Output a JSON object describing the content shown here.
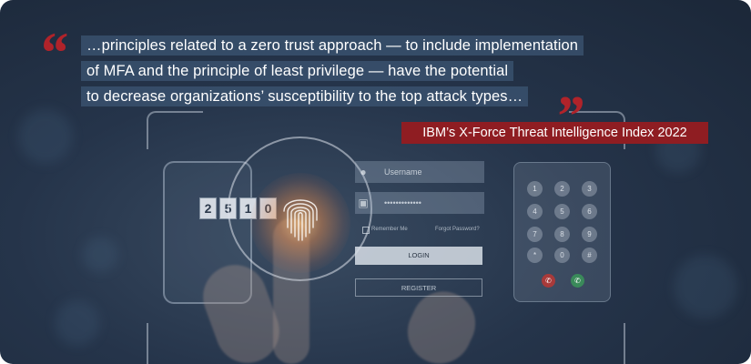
{
  "quote": {
    "lines": [
      "…principles related to a zero trust approach — to include implementation",
      "of MFA and the principle of least privilege — have the potential",
      "to decrease organizations’ susceptibility to the top attack types…"
    ],
    "source": "IBM’s X-Force Threat Intelligence Index 2022"
  },
  "colors": {
    "accent": "#8f1d22",
    "quote_mark": "#b0232a",
    "background": "#25344a"
  },
  "illustration": {
    "counter_digits": [
      "2",
      "5",
      "1",
      "0"
    ],
    "login_form": {
      "username_placeholder": "Username",
      "password_value": "•••••••••••••",
      "remember_label": "Remember Me",
      "forgot_label": "Forgot Password?",
      "login_label": "LOGIN",
      "register_label": "REGISTER",
      "user_icon": "user-icon",
      "lock_icon": "lock-icon"
    },
    "keypad_keys": [
      "1",
      "2",
      "3",
      "4",
      "5",
      "6",
      "7",
      "8",
      "9",
      "*",
      "0",
      "#"
    ],
    "call_icons": [
      "hang-up-icon",
      "call-icon"
    ]
  }
}
